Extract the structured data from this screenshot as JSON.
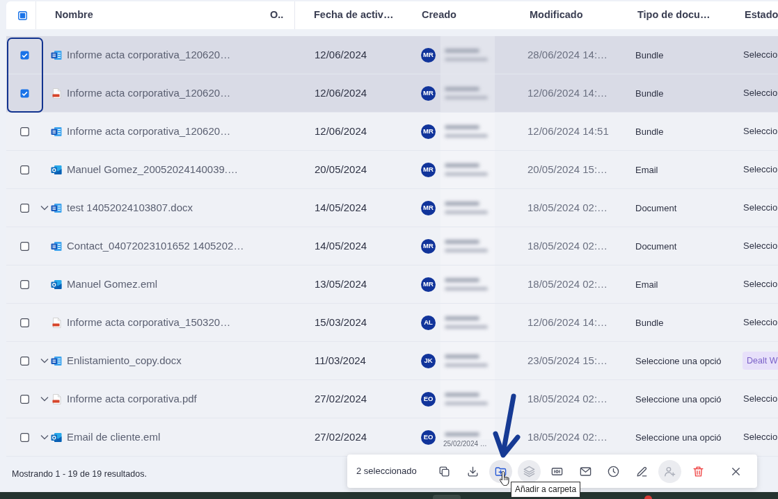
{
  "select_all": {
    "indeterminate": true
  },
  "columns": [
    "Nombre",
    "O..",
    "Fecha de activ…",
    "Creado",
    "Modificado",
    "Tipo de docu…",
    "Estado"
  ],
  "rows": [
    {
      "selected": true,
      "expandable": false,
      "kind": "doc",
      "name": "Informe acta corporativa_120620…",
      "activation_date": "12/06/2024",
      "creator": {
        "initials": "MR"
      },
      "modified": "28/06/2024 14:…",
      "document_type": "Bundle",
      "status": {
        "kind": "plain",
        "text": "Seleccio"
      }
    },
    {
      "selected": true,
      "expandable": false,
      "kind": "pdf",
      "name": "Informe acta corporativa_120620…",
      "activation_date": "12/06/2024",
      "creator": {
        "initials": "MR"
      },
      "modified": "12/06/2024 14:…",
      "document_type": "Bundle",
      "status": {
        "kind": "plain",
        "text": "Seleccio"
      }
    },
    {
      "selected": false,
      "expandable": false,
      "kind": "doc",
      "name": "Informe acta corporativa_120620…",
      "activation_date": "12/06/2024",
      "creator": {
        "initials": "MR"
      },
      "modified": "12/06/2024 14:51",
      "document_type": "Bundle",
      "status": {
        "kind": "plain",
        "text": "Seleccio"
      }
    },
    {
      "selected": false,
      "expandable": false,
      "kind": "mail",
      "name": "Manuel Gomez_20052024140039.…",
      "activation_date": "20/05/2024",
      "creator": {
        "initials": "MR"
      },
      "modified": "20/05/2024 15:…",
      "document_type": "Email",
      "status": {
        "kind": "plain",
        "text": "Seleccio"
      }
    },
    {
      "selected": false,
      "expandable": true,
      "kind": "doc",
      "name": "test 14052024103807.docx",
      "activation_date": "14/05/2024",
      "creator": {
        "initials": "MR"
      },
      "modified": "18/05/2024 02:…",
      "document_type": "Document",
      "status": {
        "kind": "plain",
        "text": "Seleccio"
      }
    },
    {
      "selected": false,
      "expandable": false,
      "kind": "doc",
      "name": "Contact_04072023101652 1405202…",
      "activation_date": "14/05/2024",
      "creator": {
        "initials": "MR"
      },
      "modified": "18/05/2024 02:…",
      "document_type": "Document",
      "status": {
        "kind": "plain",
        "text": "Seleccio"
      }
    },
    {
      "selected": false,
      "expandable": false,
      "kind": "mail",
      "name": "Manuel Gomez.eml",
      "activation_date": "13/05/2024",
      "creator": {
        "initials": "MR"
      },
      "modified": "18/05/2024 02:…",
      "document_type": "Email",
      "status": {
        "kind": "plain",
        "text": "Seleccio"
      }
    },
    {
      "selected": false,
      "expandable": false,
      "kind": "pdf",
      "name": "Informe acta corporativa_150320…",
      "activation_date": "15/03/2024",
      "creator": {
        "initials": "AL"
      },
      "modified": "12/06/2024 14:…",
      "document_type": "Bundle",
      "status": {
        "kind": "plain",
        "text": "Seleccio"
      }
    },
    {
      "selected": false,
      "expandable": true,
      "kind": "doc",
      "name": "Enlistamiento_copy.docx",
      "activation_date": "11/03/2024",
      "creator": {
        "initials": "JK"
      },
      "modified": "23/05/2024 15:…",
      "document_type": "Seleccione una opció",
      "status": {
        "kind": "badge",
        "text": "Dealt W"
      }
    },
    {
      "selected": false,
      "expandable": true,
      "kind": "pdf",
      "name": "Informe acta corporativa.pdf",
      "activation_date": "27/02/2024",
      "creator": {
        "initials": "EO"
      },
      "modified": "18/05/2024 02:…",
      "document_type": "Seleccione una opció",
      "status": {
        "kind": "plain",
        "text": "Seleccio"
      }
    },
    {
      "selected": false,
      "expandable": true,
      "kind": "mail",
      "name": "Email de cliente.eml",
      "activation_date": "27/02/2024",
      "creator": {
        "initials": "EO",
        "date": "25/02/2024 …"
      },
      "modified": "18/05/2024 02:…",
      "document_type": "Seleccione una opció",
      "status": {
        "kind": "plain",
        "text": "Seleccio"
      }
    }
  ],
  "footer": {
    "summary": "Mostrando 1 - 19 de 19 resultados."
  },
  "selection_bar": {
    "count": "2 seleccionado",
    "actions": [
      {
        "kind": "copy",
        "disabled": false,
        "hovered": false
      },
      {
        "kind": "download",
        "disabled": false,
        "hovered": false
      },
      {
        "kind": "add-to-folder",
        "disabled": false,
        "hovered": true,
        "tooltip": "Añadir a carpeta"
      },
      {
        "kind": "layers",
        "disabled": true,
        "hovered": false
      },
      {
        "kind": "card",
        "disabled": false,
        "hovered": false
      },
      {
        "kind": "email",
        "disabled": false,
        "hovered": false
      },
      {
        "kind": "history",
        "disabled": false,
        "hovered": false
      },
      {
        "kind": "edit",
        "disabled": false,
        "hovered": false
      },
      {
        "kind": "add-user",
        "disabled": true,
        "hovered": false
      },
      {
        "kind": "delete",
        "disabled": false,
        "hovered": false
      },
      {
        "kind": "close",
        "disabled": false,
        "hovered": false
      }
    ]
  },
  "annotations": {
    "frame": true,
    "arrow": true
  }
}
